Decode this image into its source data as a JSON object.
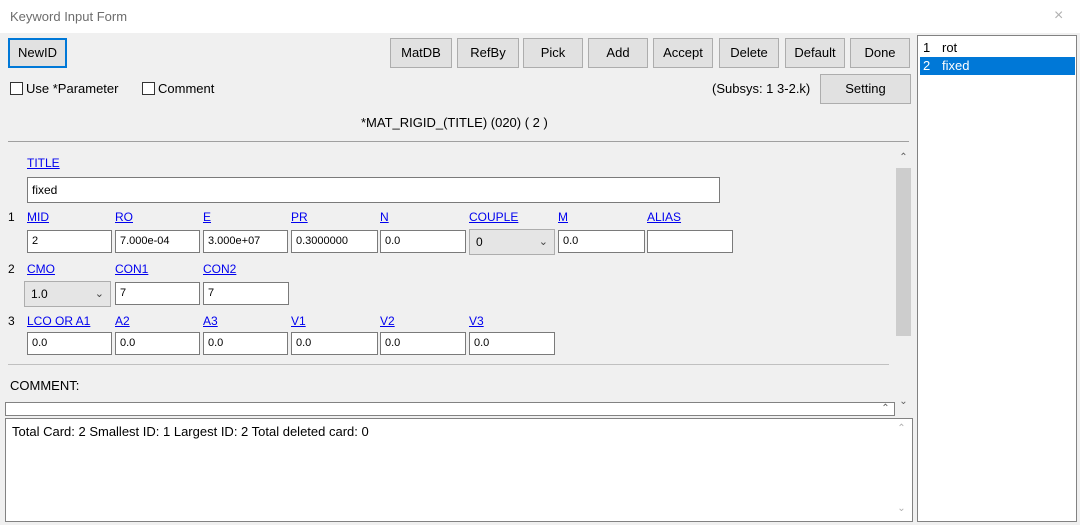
{
  "window": {
    "title": "Keyword Input Form",
    "close_glyph": "×"
  },
  "toolbar": {
    "newid": "NewID",
    "matdb": "MatDB",
    "refby": "RefBy",
    "pick": "Pick",
    "add": "Add",
    "accept": "Accept",
    "delete": "Delete",
    "default": "Default",
    "done": "Done"
  },
  "options": {
    "use_parameter": "Use *Parameter",
    "comment": "Comment",
    "subsys": "(Subsys: 1 3-2.k)",
    "setting": "Setting"
  },
  "keyword_header": "*MAT_RIGID_(TITLE) (020)    ( 2 )",
  "form": {
    "title_label": "TITLE",
    "title_value": "fixed",
    "row1": {
      "num": "1",
      "labels": [
        "MID",
        "RO",
        "E",
        "PR",
        "N",
        "COUPLE",
        "M",
        "ALIAS"
      ],
      "mid": "2",
      "ro": "7.000e-04",
      "e": "3.000e+07",
      "pr": "0.3000000",
      "n": "0.0",
      "couple": "0",
      "m": "0.0",
      "alias": ""
    },
    "row2": {
      "num": "2",
      "labels": [
        "CMO",
        "CON1",
        "CON2"
      ],
      "cmo": "1.0",
      "con1": "7",
      "con2": "7"
    },
    "row3": {
      "num": "3",
      "labels": [
        "LCO OR A1",
        "A2",
        "A3",
        "V1",
        "V2",
        "V3"
      ],
      "values": [
        "0.0",
        "0.0",
        "0.0",
        "0.0",
        "0.0",
        "0.0"
      ]
    },
    "comment_label": "COMMENT:"
  },
  "status": "Total Card: 2    Smallest ID: 1    Largest ID: 2    Total deleted card:  0",
  "list": {
    "items": [
      {
        "num": "1",
        "name": "rot",
        "selected": false
      },
      {
        "num": "2",
        "name": "fixed",
        "selected": true
      }
    ]
  },
  "colors": {
    "selection": "#0078d7",
    "link": "#0000ee",
    "accent_border": "#0078d7"
  }
}
